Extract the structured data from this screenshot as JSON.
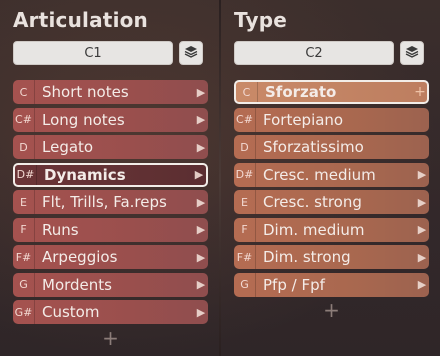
{
  "articulation": {
    "title": "Articulation",
    "channel": "C1",
    "items": [
      {
        "note": "C",
        "label": "Short notes",
        "selected": false
      },
      {
        "note": "C#",
        "label": "Long notes",
        "selected": false
      },
      {
        "note": "D",
        "label": "Legato",
        "selected": false
      },
      {
        "note": "D#",
        "label": "Dynamics",
        "selected": true
      },
      {
        "note": "E",
        "label": "Flt, Trills, Fa.reps",
        "selected": false
      },
      {
        "note": "F",
        "label": "Runs",
        "selected": false
      },
      {
        "note": "F#",
        "label": "Arpeggios",
        "selected": false
      },
      {
        "note": "G",
        "label": "Mordents",
        "selected": false
      },
      {
        "note": "G#",
        "label": "Custom",
        "selected": false
      }
    ],
    "add_label": "+"
  },
  "type": {
    "title": "Type",
    "channel": "C2",
    "items": [
      {
        "note": "C",
        "label": "Sforzato",
        "selected": true
      },
      {
        "note": "C#",
        "label": "Fortepiano",
        "selected": false
      },
      {
        "note": "D",
        "label": "Sforzatissimo",
        "selected": false
      },
      {
        "note": "D#",
        "label": "Cresc. medium",
        "selected": false
      },
      {
        "note": "E",
        "label": "Cresc. strong",
        "selected": false
      },
      {
        "note": "F",
        "label": "Dim. medium",
        "selected": false
      },
      {
        "note": "F#",
        "label": "Dim. strong",
        "selected": false
      },
      {
        "note": "G",
        "label": "Pfp / Fpf",
        "selected": false
      }
    ],
    "add_label": "+"
  },
  "icons": {
    "layers": "layers-icon",
    "chevron": "chevron-right-icon",
    "plus": "plus-icon"
  }
}
